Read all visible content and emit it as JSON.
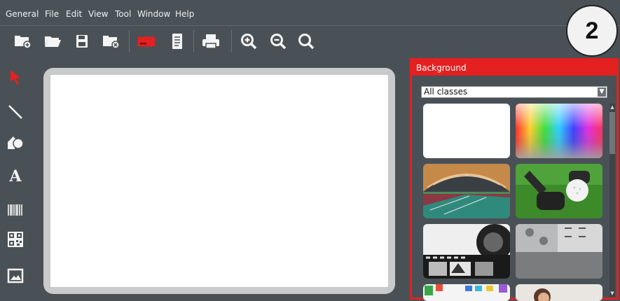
{
  "menu": {
    "items": [
      "General",
      "File",
      "Edit",
      "View",
      "Tool",
      "Window",
      "Help"
    ]
  },
  "toolbar": {
    "icons": [
      "new-document-icon",
      "open-folder-icon",
      "save-icon",
      "close-document-icon",
      "card-icon",
      "page-icon",
      "print-icon",
      "zoom-in-icon",
      "zoom-out-icon",
      "zoom-fit-icon"
    ]
  },
  "left_tools": {
    "icons": [
      "select-arrow-icon",
      "line-icon",
      "shapes-icon",
      "text-icon",
      "barcode-icon",
      "qrcode-icon",
      "image-icon"
    ],
    "text_tool_glyph": "A"
  },
  "panel": {
    "title": "Background",
    "select_value": "All classes",
    "thumbnails": [
      "white-background",
      "color-spectrum",
      "tennis-court",
      "golf-ball",
      "film-strip",
      "concrete-wall",
      "colorful-shapes",
      "person-photo"
    ]
  },
  "badge": {
    "label": "2"
  },
  "colors": {
    "accent": "#e42020",
    "panel_bg": "#4a5156",
    "canvas": "#ffffff"
  }
}
